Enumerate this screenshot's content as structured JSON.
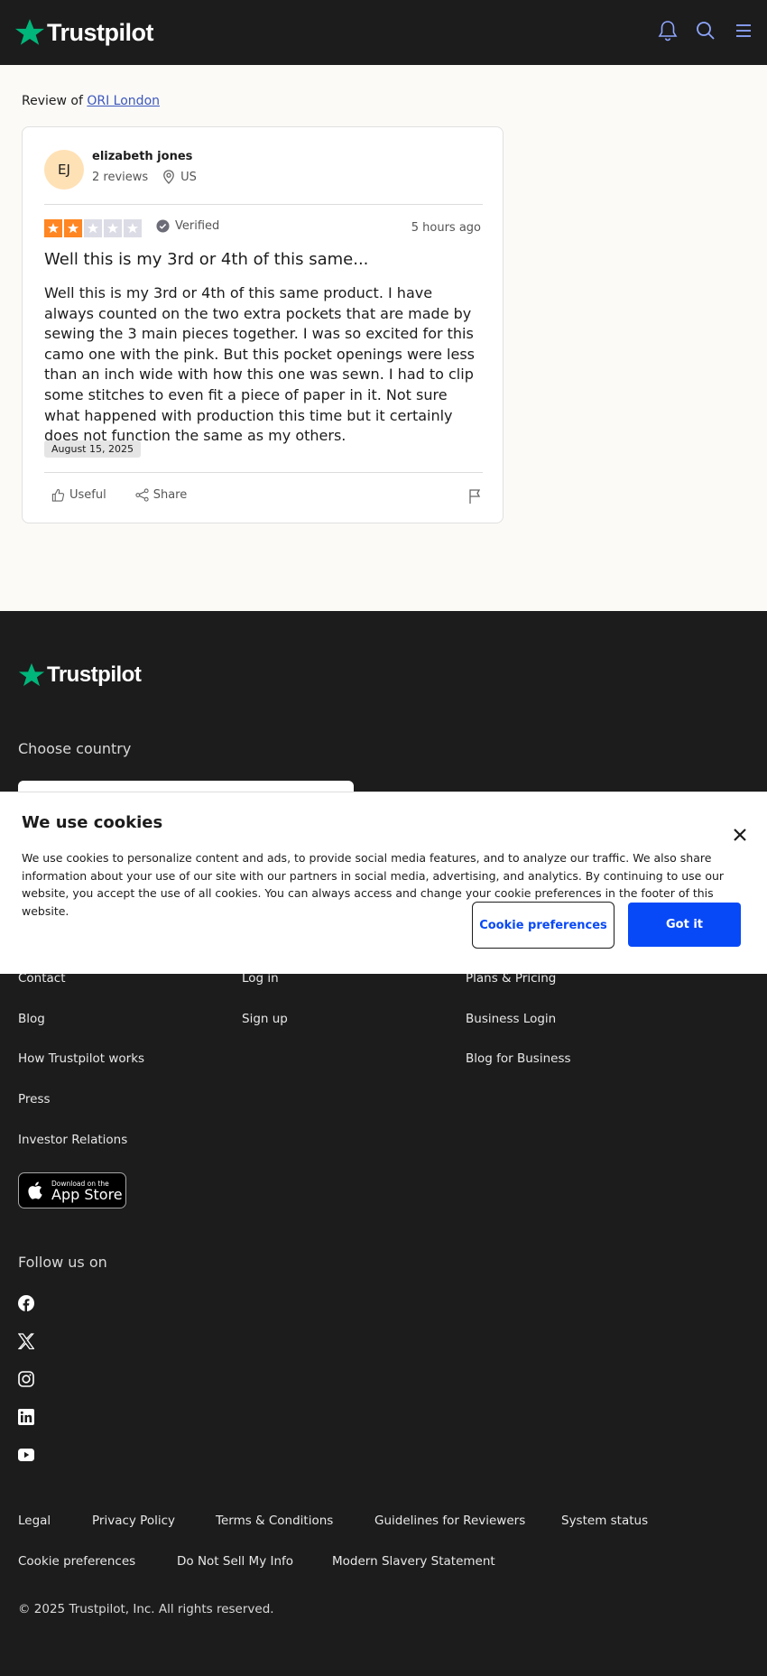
{
  "header": {
    "brand": "Trustpilot"
  },
  "review_of": {
    "prefix": "Review of",
    "company": "ORI London"
  },
  "reviewer": {
    "initials": "EJ",
    "name": "elizabeth jones",
    "reviews": "2 reviews",
    "country": "US"
  },
  "review": {
    "rating": 2,
    "max_rating": 5,
    "verified": "Verified",
    "time": "5 hours ago",
    "title": "Well this is my 3rd or 4th of this same...",
    "body": "Well this is my 3rd or 4th of this same product. I have always counted on the two extra pockets that are made by sewing the 3 main pieces together. I was so excited for this camo one with the pink. But this pocket openings were less than an inch wide with how this one was sewn. I had to clip some stitches to even fit a piece of paper in it. Not sure what happened with production this time but it certainly does not function the same as my others.",
    "date": "August 15, 2025",
    "useful": "Useful",
    "share": "Share"
  },
  "footer": {
    "brand": "Trustpilot",
    "choose_country": "Choose country",
    "col1": [
      "Contact",
      "Blog",
      "How Trustpilot works",
      "Press",
      "Investor Relations"
    ],
    "col2": [
      "Log in",
      "Sign up"
    ],
    "col3": [
      "Plans & Pricing",
      "Business Login",
      "Blog for Business"
    ],
    "app_store_small": "Download on the",
    "app_store_big": "App Store",
    "follow_us": "Follow us on",
    "social": [
      "facebook-icon",
      "x-icon",
      "instagram-icon",
      "linkedin-icon",
      "youtube-icon"
    ],
    "legal_row1": [
      "Legal",
      "Privacy Policy",
      "Terms & Conditions",
      "Guidelines for Reviewers",
      "System status"
    ],
    "legal_row2": [
      "Cookie preferences",
      "Do Not Sell My Info",
      "Modern Slavery Statement"
    ],
    "copyright": "© 2025 Trustpilot, Inc. All rights reserved."
  },
  "cookie": {
    "title": "We use cookies",
    "text": "We use cookies to personalize content and ads, to provide social media features, and to analyze our traffic. We also share information about your use of our site with our partners in social media, advertising, and analytics. By continuing to use our website, you accept the use of all cookies. You can always access and change your cookie preferences in the footer of this website.",
    "prefs_button": "Cookie preferences",
    "accept_button": "Got it"
  },
  "colors": {
    "brand_green": "#00b67a",
    "star_orange": "#ff8622",
    "link_blue": "#3c57bc",
    "button_blue": "#0849f7"
  }
}
